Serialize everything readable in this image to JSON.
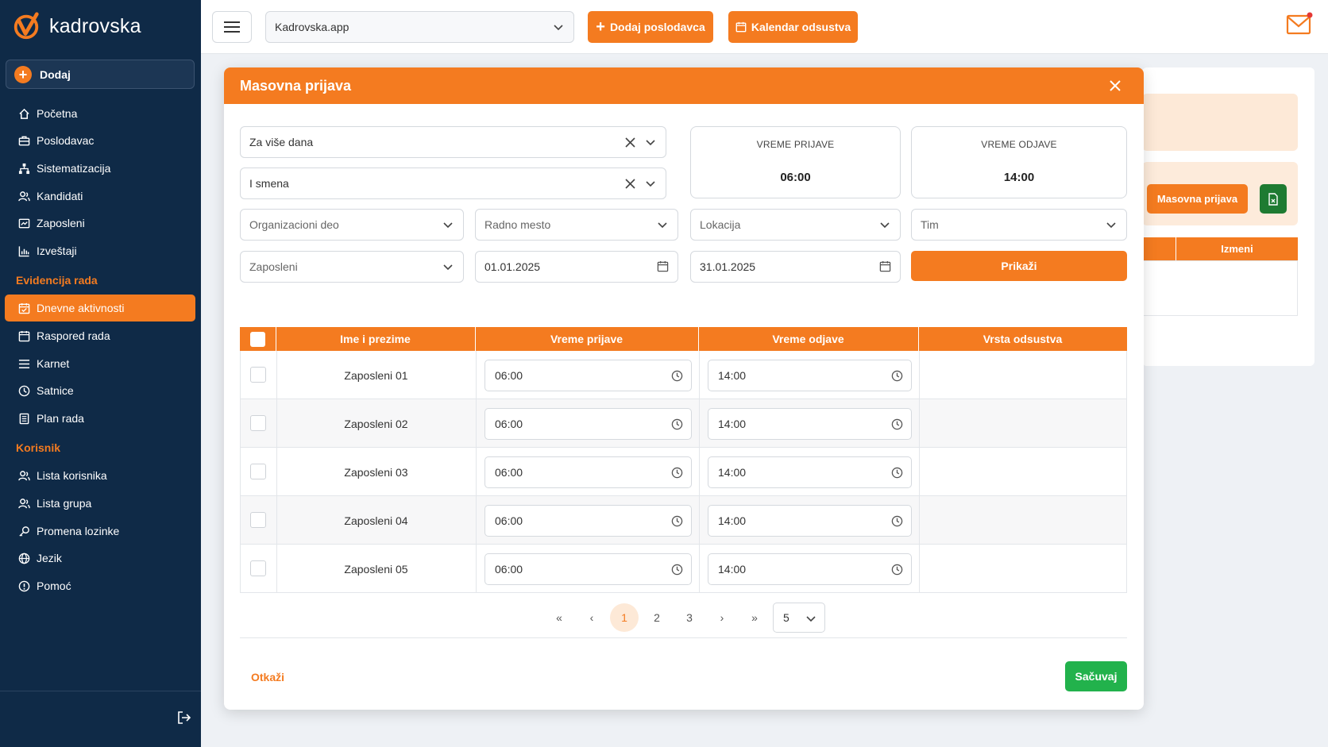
{
  "brand": {
    "name": "kadrovska"
  },
  "sidebar": {
    "add_label": "Dodaj",
    "items": [
      {
        "label": "Početna",
        "icon": "home-icon"
      },
      {
        "label": "Poslodavac",
        "icon": "briefcase-icon"
      },
      {
        "label": "Sistematizacija",
        "icon": "hierarchy-icon"
      },
      {
        "label": "Kandidati",
        "icon": "users-icon"
      },
      {
        "label": "Zaposleni",
        "icon": "id-card-icon"
      },
      {
        "label": "Izveštaji",
        "icon": "bar-chart-icon"
      }
    ],
    "section_evidencija": "Evidencija rada",
    "evidencija_items": [
      {
        "label": "Dnevne aktivnosti",
        "icon": "calendar-check-icon",
        "active": true
      },
      {
        "label": "Raspored rada",
        "icon": "calendar-icon"
      },
      {
        "label": "Karnet",
        "icon": "list-icon"
      },
      {
        "label": "Satnice",
        "icon": "clock-icon"
      },
      {
        "label": "Plan rada",
        "icon": "document-icon"
      }
    ],
    "section_korisnik": "Korisnik",
    "korisnik_items": [
      {
        "label": "Lista korisnika",
        "icon": "users-icon"
      },
      {
        "label": "Lista grupa",
        "icon": "users-icon"
      },
      {
        "label": "Promena lozinke",
        "icon": "key-icon"
      },
      {
        "label": "Jezik",
        "icon": "globe-icon"
      },
      {
        "label": "Pomoć",
        "icon": "info-icon"
      }
    ]
  },
  "topbar": {
    "company": "Kadrovska.app",
    "add_employer": "Dodaj poslodavca",
    "absence_calendar": "Kalendar odsustva"
  },
  "background": {
    "masovna_button": "Masovna prijava",
    "izmeni_header": "Izmeni"
  },
  "modal": {
    "title": "Masovna prijava",
    "period_select": "Za više dana",
    "shift_select": "I smena",
    "checkin_card": {
      "label": "VREME PRIJAVE",
      "value": "06:00"
    },
    "checkout_card": {
      "label": "VREME ODJAVE",
      "value": "14:00"
    },
    "filters": {
      "org_unit": "Organizacioni deo",
      "position": "Radno mesto",
      "location": "Lokacija",
      "team": "Tim",
      "employees": "Zaposleni",
      "date_from": "01.01.2025",
      "date_to": "31.01.2025"
    },
    "show_button": "Prikaži",
    "table": {
      "headers": [
        "Ime i prezime",
        "Vreme prijave",
        "Vreme odjave",
        "Vrsta odsustva"
      ],
      "rows": [
        {
          "name": "Zaposleni  01",
          "checkin": "06:00",
          "checkout": "14:00",
          "absence": ""
        },
        {
          "name": "Zaposleni  02",
          "checkin": "06:00",
          "checkout": "14:00",
          "absence": ""
        },
        {
          "name": "Zaposleni  03",
          "checkin": "06:00",
          "checkout": "14:00",
          "absence": ""
        },
        {
          "name": "Zaposleni  04",
          "checkin": "06:00",
          "checkout": "14:00",
          "absence": ""
        },
        {
          "name": "Zaposleni  05",
          "checkin": "06:00",
          "checkout": "14:00",
          "absence": ""
        }
      ]
    },
    "pagination": {
      "first": "«",
      "prev": "‹",
      "pages": [
        "1",
        "2",
        "3"
      ],
      "current": "1",
      "next": "›",
      "last": "»",
      "page_size": "5"
    },
    "cancel": "Otkaži",
    "save": "Sačuvaj"
  },
  "colors": {
    "sidebar_bg": "#0f2a47",
    "accent": "#f47b20",
    "save_green": "#22b24c"
  }
}
